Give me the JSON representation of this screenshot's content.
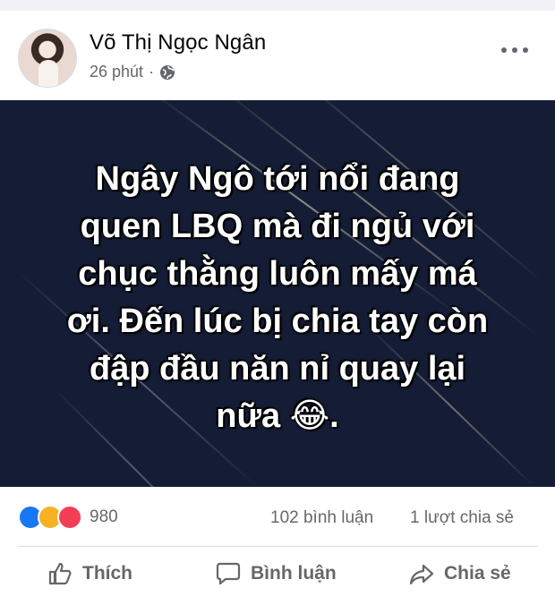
{
  "post": {
    "author": "Võ Thị Ngọc Ngân",
    "time": "26 phút",
    "separator": "·",
    "privacy_icon": "globe-icon",
    "menu_icon": "more-icon"
  },
  "image": {
    "text": "Ngây Ngô tới nổi đang\nquen LBQ mà đi ngủ với\nchục thằng luôn mấy má\nơi. Đến lúc bị chia tay còn\nđập đầu năn nỉ quay lại\nnữa 😂."
  },
  "stats": {
    "reaction_icons": [
      "like-reaction-icon",
      "haha-reaction-icon",
      "love-reaction-icon"
    ],
    "reaction_count": "980",
    "comments": "102 bình luận",
    "shares": "1 lượt chia sẻ"
  },
  "actions": {
    "like": "Thích",
    "comment": "Bình luận",
    "share": "Chia sẻ"
  },
  "colors": {
    "image_bg": "#151d36",
    "meta_text": "#65676b",
    "like_blue": "#1877f2"
  }
}
